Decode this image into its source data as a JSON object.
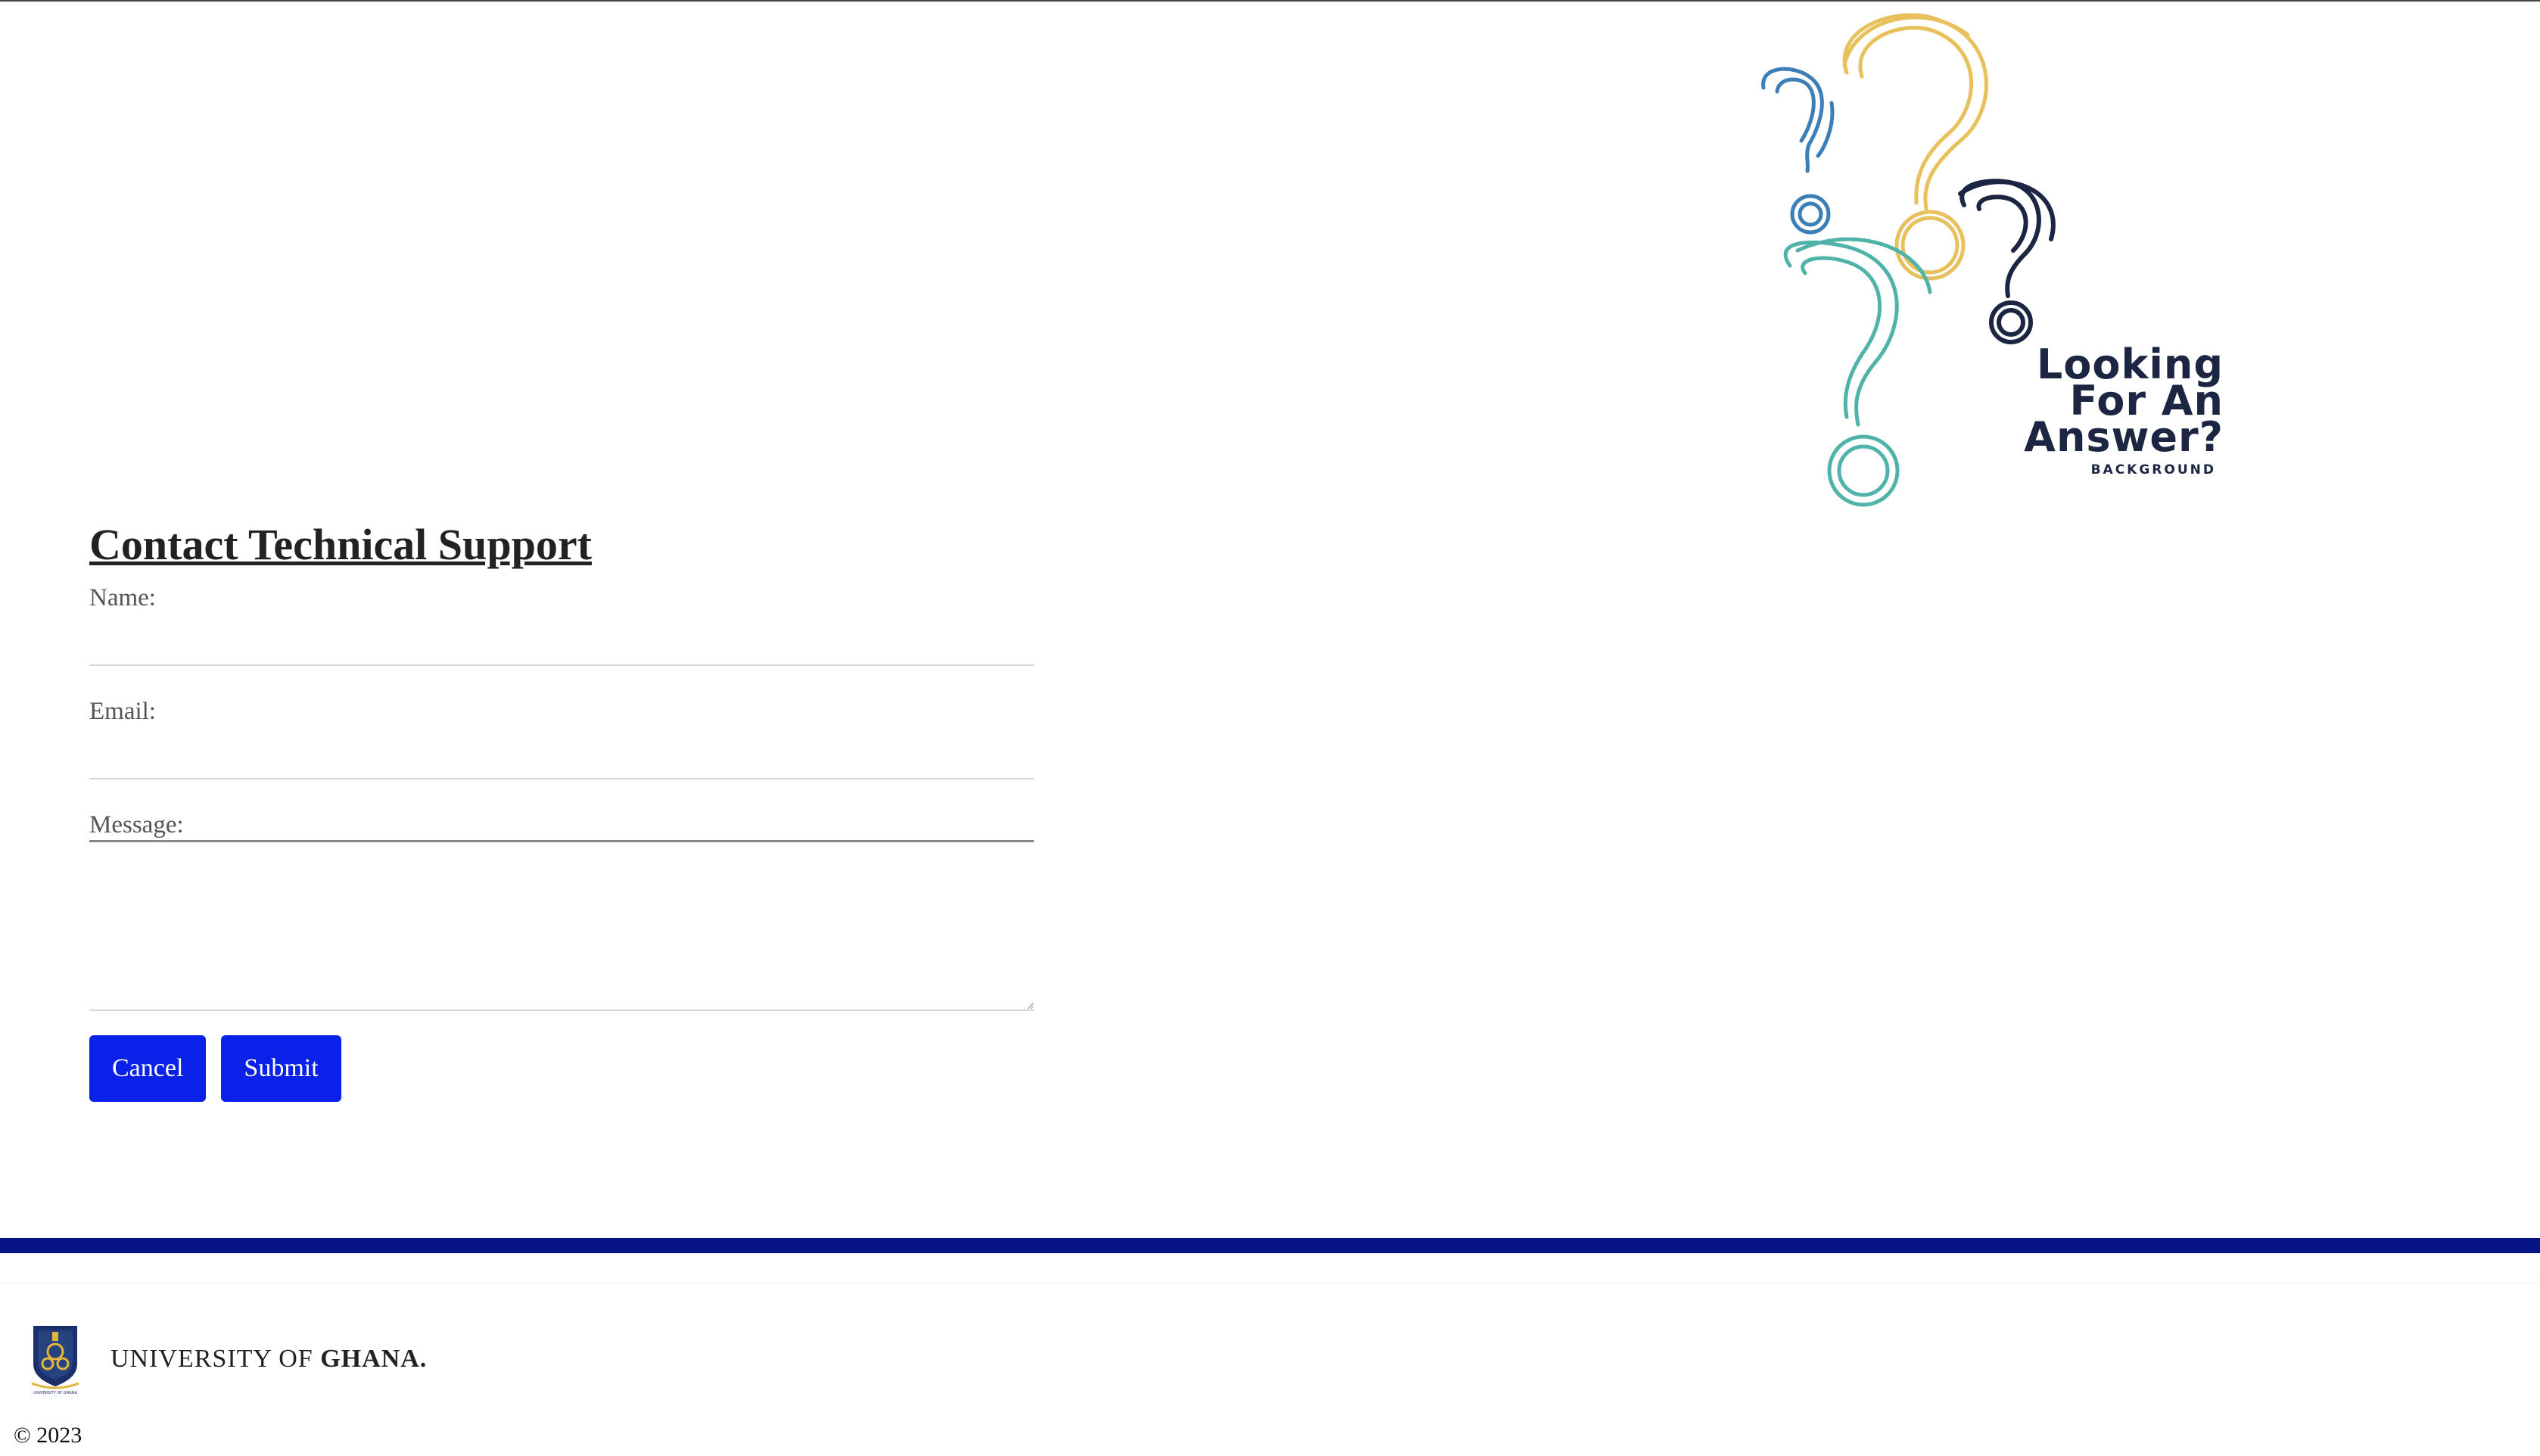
{
  "illustration": {
    "headline_lines": [
      "Looking",
      "For An",
      "Answer?"
    ],
    "subtext": "BACKGROUND",
    "icon": "question-marks-illustration",
    "colors": {
      "yellow": "#e8c15c",
      "blue": "#3c7fb8",
      "teal": "#4fb3a9",
      "navy": "#1c2541"
    }
  },
  "form": {
    "title": "Contact Technical Support",
    "name_label": "Name:",
    "email_label": "Email:",
    "message_label": "Message:",
    "name_value": "",
    "email_value": "",
    "message_value": "",
    "cancel_label": "Cancel",
    "submit_label": "Submit",
    "button_color": "#0a22e8"
  },
  "footer": {
    "bar_color": "#061483",
    "university_prefix": "UNIVERSITY OF ",
    "university_name": "GHANA.",
    "crest_caption": "UNIVERSITY OF GHANA",
    "crest_icon": "university-crest-icon",
    "copyright": "© 2023"
  }
}
